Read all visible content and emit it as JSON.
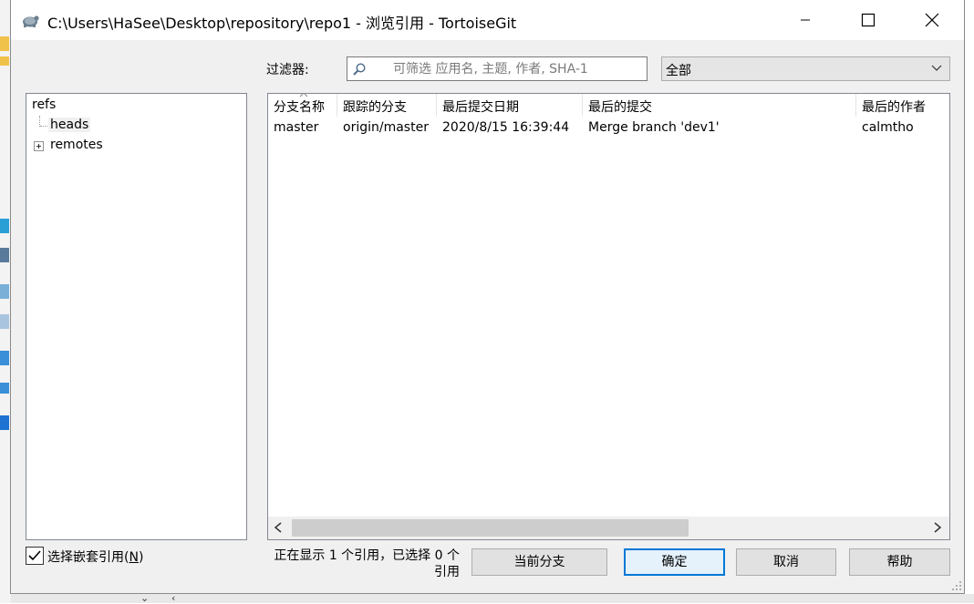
{
  "window": {
    "title": "C:\\Users\\HaSee\\Desktop\\repository\\repo1 - 浏览引用 - TortoiseGit"
  },
  "filter": {
    "label": "过滤器:",
    "placeholder": "可筛选 应用名, 主题, 作者, SHA-1",
    "value": ""
  },
  "scope": {
    "selected": "全部"
  },
  "tree": {
    "root": "refs",
    "heads": "heads",
    "remotes": "remotes"
  },
  "list": {
    "columns": [
      "分支名称",
      "跟踪的分支",
      "最后提交日期",
      "最后的提交",
      "最后的作者"
    ],
    "rows": [
      {
        "branch": "master",
        "tracking": "origin/master",
        "date": "2020/8/15 16:39:44",
        "commit": "Merge branch 'dev1'",
        "author": "calmtho"
      }
    ]
  },
  "footer": {
    "nested_label": "选择嵌套引用",
    "nested_accel": "N",
    "nested_checked": true,
    "status_line1": "正在显示 1 个引用，已选择 0 个",
    "status_line2": "引用"
  },
  "buttons": {
    "current_branch": "当前分支",
    "ok": "确定",
    "cancel": "取消",
    "help": "帮助"
  },
  "colors": {
    "focus_border": "#0078d7",
    "dialog_bg": "#f0f0f0"
  }
}
